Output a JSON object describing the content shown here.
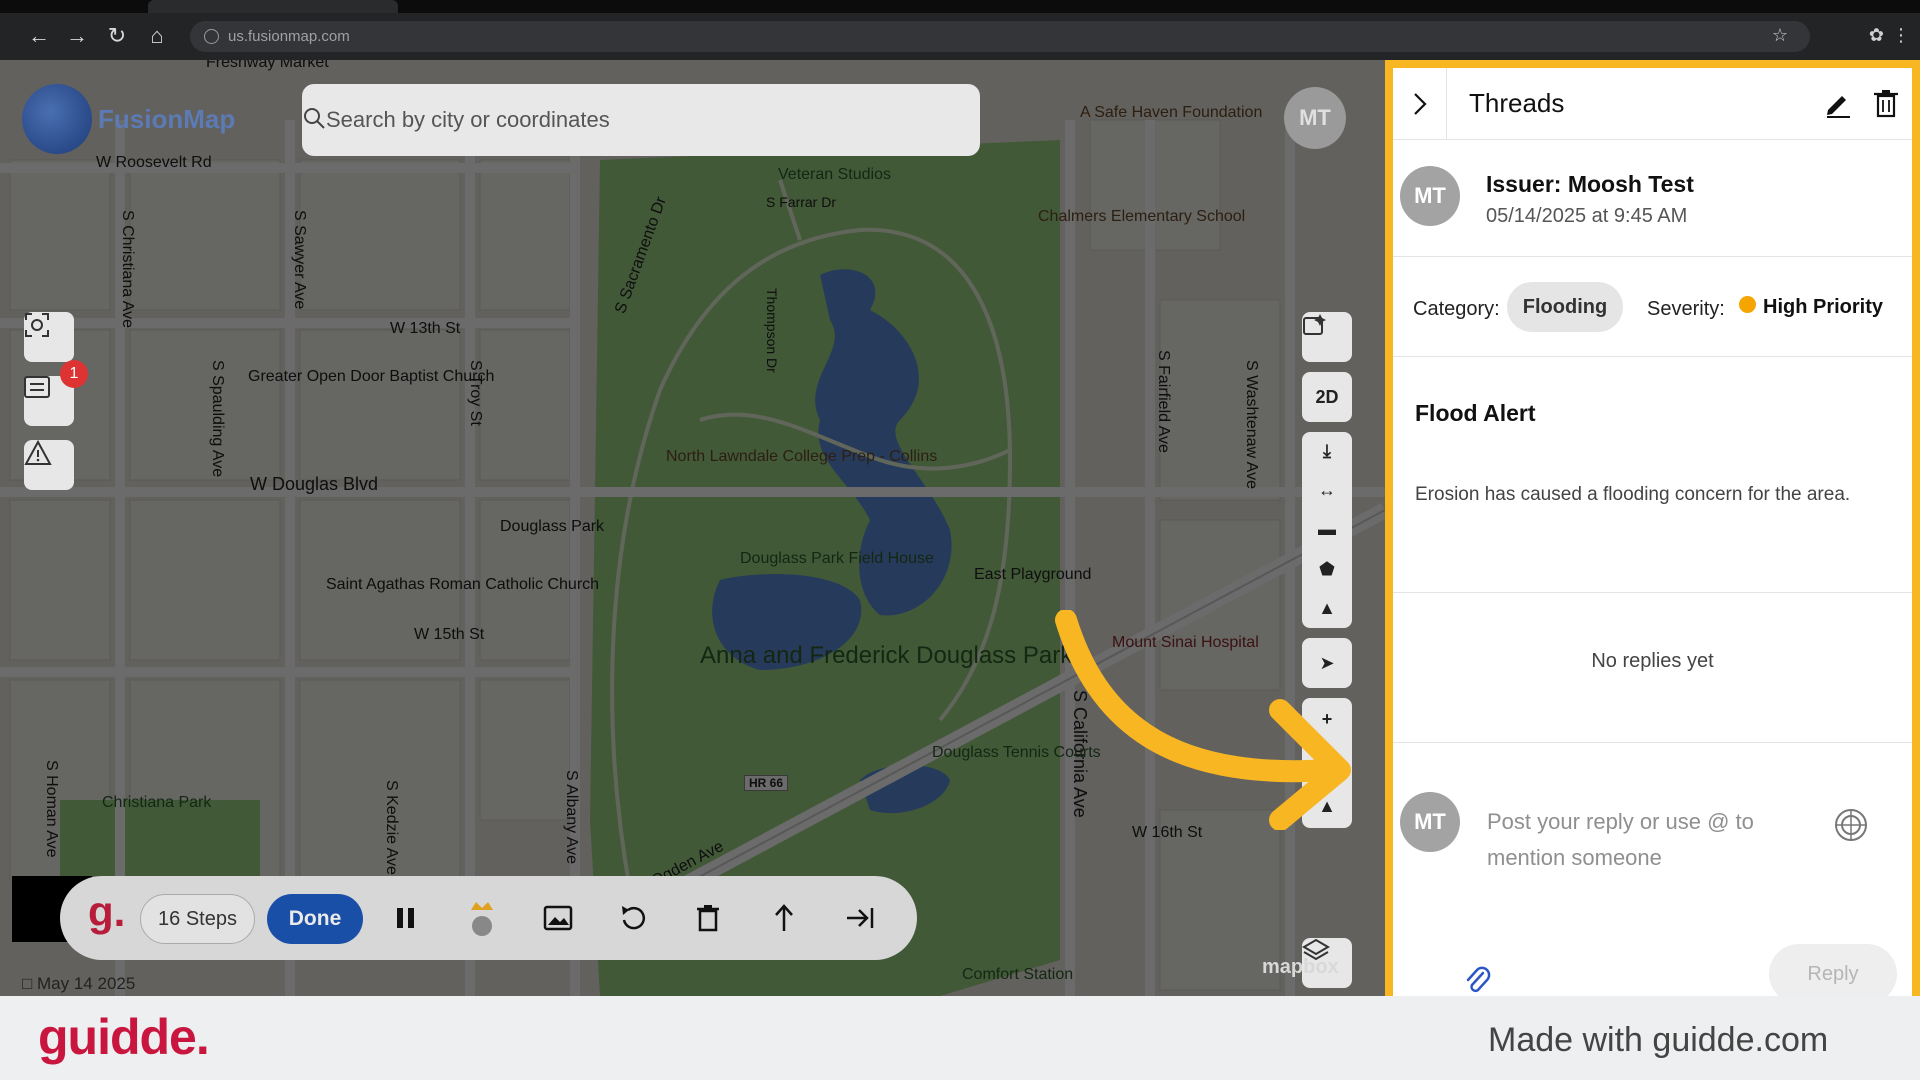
{
  "browser": {
    "url": "us.fusionmap.com"
  },
  "app": {
    "logo_text": "FusionMap",
    "search_placeholder": "Search by city or coordinates",
    "user_initials": "MT",
    "notification_count": "1",
    "date_label": "May 14 2025",
    "attribution": "mapbox",
    "map_mode": "2D"
  },
  "map_labels": {
    "streets": [
      "W Roosevelt Rd",
      "W 13th St",
      "W Douglas Blvd",
      "W 15th St",
      "W 16th St",
      "W Ogden Ave",
      "S Christiana Ave",
      "S Sawyer Ave",
      "S Spaulding Ave",
      "S Troy St",
      "S Sacramento Dr",
      "Thompson Dr",
      "S Farrar Dr",
      "S Fairfield Ave",
      "S Washtenaw Ave",
      "S California Ave",
      "S Homan Ave",
      "S Kedzie Ave",
      "S Albany Ave",
      "HR 66"
    ],
    "places": [
      "Fresnway Market",
      "A Safe Haven Foundation",
      "Chalmers Elementary School",
      "Veteran Studios",
      "Greater Open Door Baptist Church",
      "North Lawndale College Prep - Collins",
      "Douglass Park",
      "Saint Agathas Roman Catholic Church",
      "Douglass Park Field House",
      "East Playground",
      "Mount Sinai Hospital",
      "Douglass Tennis Courts",
      "Christiana Park",
      "Comfort Station"
    ],
    "park_name": "Anna and Frederick Douglass Park"
  },
  "recorder": {
    "logo": "g.",
    "steps_label": "16 Steps",
    "done_label": "Done"
  },
  "thread": {
    "title": "Threads",
    "issuer_initials": "MT",
    "issuer": "Issuer: Moosh Test",
    "issued_at": "05/14/2025 at 9:45 AM",
    "category_label": "Category:",
    "category": "Flooding",
    "severity_label": "Severity:",
    "severity": "High Priority",
    "severity_color": "#f5a400",
    "alert_title": "Flood Alert",
    "alert_body": "Erosion has caused a flooding concern for the area.",
    "no_replies": "No replies yet",
    "reply_placeholder": "Post your reply or use @ to mention someone",
    "reply_button": "Reply",
    "panel_highlight_color": "#f8b622"
  },
  "footer": {
    "brand": "guidde.",
    "made_with": "Made with guidde.com"
  }
}
